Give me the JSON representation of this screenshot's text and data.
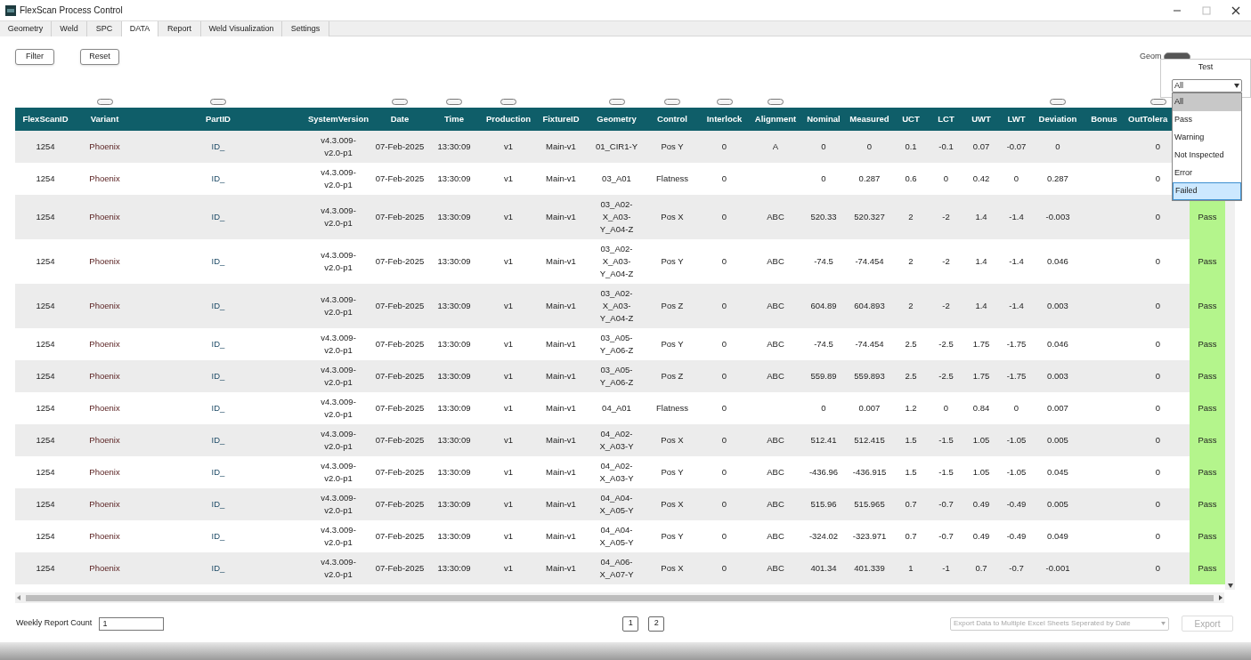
{
  "window": {
    "title": "FlexScan Process Control"
  },
  "tabs": [
    {
      "label": "Geometry",
      "selected": false
    },
    {
      "label": "Weld",
      "selected": false
    },
    {
      "label": "SPC",
      "selected": false
    },
    {
      "label": "DATA",
      "selected": true
    },
    {
      "label": "Report",
      "selected": false
    },
    {
      "label": "Weld Visualization",
      "selected": false
    },
    {
      "label": "Settings",
      "selected": false
    }
  ],
  "toolbar": {
    "buttons": [
      "Filter",
      "Reset"
    ],
    "view_toggle_label": "Geom",
    "view_toggle_on": true
  },
  "table": {
    "columns": [
      {
        "label": "FlexScanID",
        "filter_handle": false
      },
      {
        "label": "Variant",
        "filter_handle": true
      },
      {
        "label": "PartID",
        "filter_handle": true
      },
      {
        "label": "SystemVersion",
        "filter_handle": false
      },
      {
        "label": "Date",
        "filter_handle": true
      },
      {
        "label": "Time",
        "filter_handle": true
      },
      {
        "label": "Production",
        "filter_handle": true
      },
      {
        "label": "FixtureID",
        "filter_handle": false
      },
      {
        "label": "Geometry",
        "filter_handle": true
      },
      {
        "label": "Control",
        "filter_handle": true
      },
      {
        "label": "Interlock",
        "filter_handle": true
      },
      {
        "label": "Alignment",
        "filter_handle": true
      },
      {
        "label": "Nominal",
        "filter_handle": false
      },
      {
        "label": "Measured",
        "filter_handle": false
      },
      {
        "label": "UCT",
        "filter_handle": false
      },
      {
        "label": "LCT",
        "filter_handle": false
      },
      {
        "label": "UWT",
        "filter_handle": false
      },
      {
        "label": "LWT",
        "filter_handle": false
      },
      {
        "label": "Deviation",
        "filter_handle": true
      },
      {
        "label": "Bonus",
        "filter_handle": false
      },
      {
        "label": "OutTolera",
        "filter_handle": true
      }
    ],
    "rows": [
      {
        "cells": [
          "1254",
          "Phoenix",
          "ID_",
          "v4.3.009-v2.0-p1",
          "07-Feb-2025",
          "13:30:09",
          "v1",
          "Main-v1",
          "01_CIR1-Y",
          "Pos Y",
          "0",
          "A",
          "0",
          "0",
          "0.1",
          "-0.1",
          "0.07",
          "-0.07",
          "0",
          "",
          "0"
        ]
      },
      {
        "cells": [
          "1254",
          "Phoenix",
          "ID_",
          "v4.3.009-v2.0-p1",
          "07-Feb-2025",
          "13:30:09",
          "v1",
          "Main-v1",
          "03_A01",
          "Flatness",
          "0",
          "",
          "0",
          "0.287",
          "0.6",
          "0",
          "0.42",
          "0",
          "0.287",
          "",
          "0"
        ]
      },
      {
        "cells": [
          "1254",
          "Phoenix",
          "ID_",
          "v4.3.009-v2.0-p1",
          "07-Feb-2025",
          "13:30:09",
          "v1",
          "Main-v1",
          "03_A02-X_A03-Y_A04-Z",
          "Pos X",
          "0",
          "ABC",
          "520.33",
          "520.327",
          "2",
          "-2",
          "1.4",
          "-1.4",
          "-0.003",
          "",
          "0"
        ],
        "result": {
          "text": "Pass",
          "color": "#b4f58c"
        }
      },
      {
        "cells": [
          "1254",
          "Phoenix",
          "ID_",
          "v4.3.009-v2.0-p1",
          "07-Feb-2025",
          "13:30:09",
          "v1",
          "Main-v1",
          "03_A02-X_A03-Y_A04-Z",
          "Pos Y",
          "0",
          "ABC",
          "-74.5",
          "-74.454",
          "2",
          "-2",
          "1.4",
          "-1.4",
          "0.046",
          "",
          "0"
        ],
        "result": {
          "text": "Pass",
          "color": "#b4f58c"
        }
      },
      {
        "cells": [
          "1254",
          "Phoenix",
          "ID_",
          "v4.3.009-v2.0-p1",
          "07-Feb-2025",
          "13:30:09",
          "v1",
          "Main-v1",
          "03_A02-X_A03-Y_A04-Z",
          "Pos Z",
          "0",
          "ABC",
          "604.89",
          "604.893",
          "2",
          "-2",
          "1.4",
          "-1.4",
          "0.003",
          "",
          "0"
        ],
        "result": {
          "text": "Pass",
          "color": "#b4f58c"
        }
      },
      {
        "cells": [
          "1254",
          "Phoenix",
          "ID_",
          "v4.3.009-v2.0-p1",
          "07-Feb-2025",
          "13:30:09",
          "v1",
          "Main-v1",
          "03_A05-Y_A06-Z",
          "Pos Y",
          "0",
          "ABC",
          "-74.5",
          "-74.454",
          "2.5",
          "-2.5",
          "1.75",
          "-1.75",
          "0.046",
          "",
          "0"
        ],
        "result": {
          "text": "Pass",
          "color": "#b4f58c"
        }
      },
      {
        "cells": [
          "1254",
          "Phoenix",
          "ID_",
          "v4.3.009-v2.0-p1",
          "07-Feb-2025",
          "13:30:09",
          "v1",
          "Main-v1",
          "03_A05-Y_A06-Z",
          "Pos Z",
          "0",
          "ABC",
          "559.89",
          "559.893",
          "2.5",
          "-2.5",
          "1.75",
          "-1.75",
          "0.003",
          "",
          "0"
        ],
        "result": {
          "text": "Pass",
          "color": "#b4f58c"
        }
      },
      {
        "cells": [
          "1254",
          "Phoenix",
          "ID_",
          "v4.3.009-v2.0-p1",
          "07-Feb-2025",
          "13:30:09",
          "v1",
          "Main-v1",
          "04_A01",
          "Flatness",
          "0",
          "",
          "0",
          "0.007",
          "1.2",
          "0",
          "0.84",
          "0",
          "0.007",
          "",
          "0"
        ],
        "result": {
          "text": "Pass",
          "color": "#b4f58c"
        }
      },
      {
        "cells": [
          "1254",
          "Phoenix",
          "ID_",
          "v4.3.009-v2.0-p1",
          "07-Feb-2025",
          "13:30:09",
          "v1",
          "Main-v1",
          "04_A02-X_A03-Y",
          "Pos X",
          "0",
          "ABC",
          "512.41",
          "512.415",
          "1.5",
          "-1.5",
          "1.05",
          "-1.05",
          "0.005",
          "",
          "0"
        ],
        "result": {
          "text": "Pass",
          "color": "#b4f58c"
        }
      },
      {
        "cells": [
          "1254",
          "Phoenix",
          "ID_",
          "v4.3.009-v2.0-p1",
          "07-Feb-2025",
          "13:30:09",
          "v1",
          "Main-v1",
          "04_A02-X_A03-Y",
          "Pos Y",
          "0",
          "ABC",
          "-436.96",
          "-436.915",
          "1.5",
          "-1.5",
          "1.05",
          "-1.05",
          "0.045",
          "",
          "0"
        ],
        "result": {
          "text": "Pass",
          "color": "#b4f58c"
        }
      },
      {
        "cells": [
          "1254",
          "Phoenix",
          "ID_",
          "v4.3.009-v2.0-p1",
          "07-Feb-2025",
          "13:30:09",
          "v1",
          "Main-v1",
          "04_A04-X_A05-Y",
          "Pos X",
          "0",
          "ABC",
          "515.96",
          "515.965",
          "0.7",
          "-0.7",
          "0.49",
          "-0.49",
          "0.005",
          "",
          "0"
        ],
        "result": {
          "text": "Pass",
          "color": "#b4f58c"
        }
      },
      {
        "cells": [
          "1254",
          "Phoenix",
          "ID_",
          "v4.3.009-v2.0-p1",
          "07-Feb-2025",
          "13:30:09",
          "v1",
          "Main-v1",
          "04_A04-X_A05-Y",
          "Pos Y",
          "0",
          "ABC",
          "-324.02",
          "-323.971",
          "0.7",
          "-0.7",
          "0.49",
          "-0.49",
          "0.049",
          "",
          "0"
        ],
        "result": {
          "text": "Pass",
          "color": "#b4f58c"
        }
      },
      {
        "cells": [
          "1254",
          "Phoenix",
          "ID_",
          "v4.3.009-v2.0-p1",
          "07-Feb-2025",
          "13:30:09",
          "v1",
          "Main-v1",
          "04_A06-X_A07-Y",
          "Pos X",
          "0",
          "ABC",
          "401.34",
          "401.339",
          "1",
          "-1",
          "0.7",
          "-0.7",
          "-0.001",
          "",
          "0"
        ],
        "result": {
          "text": "Pass",
          "color": "#b4f58c"
        }
      }
    ]
  },
  "test_filter": {
    "label": "Test",
    "value": "All",
    "options": [
      {
        "label": "All",
        "selected": true,
        "highlighted": false
      },
      {
        "label": "Pass",
        "selected": false,
        "highlighted": false
      },
      {
        "label": "Warning",
        "selected": false,
        "highlighted": false
      },
      {
        "label": "Not Inspected",
        "selected": false,
        "highlighted": false
      },
      {
        "label": "Error",
        "selected": false,
        "highlighted": false
      },
      {
        "label": "Failed",
        "selected": false,
        "highlighted": true
      }
    ]
  },
  "footer": {
    "weekly_report_label": "Weekly Report Count",
    "weekly_report_value": "1",
    "pages": [
      {
        "label": "1",
        "selected": false
      },
      {
        "label": "2",
        "selected": false
      }
    ],
    "export_mode": {
      "value": "Export Data to Multiple Excel Sheets Seperated by Date",
      "disabled": true
    },
    "export_button": {
      "label": "Export",
      "disabled": true
    }
  }
}
